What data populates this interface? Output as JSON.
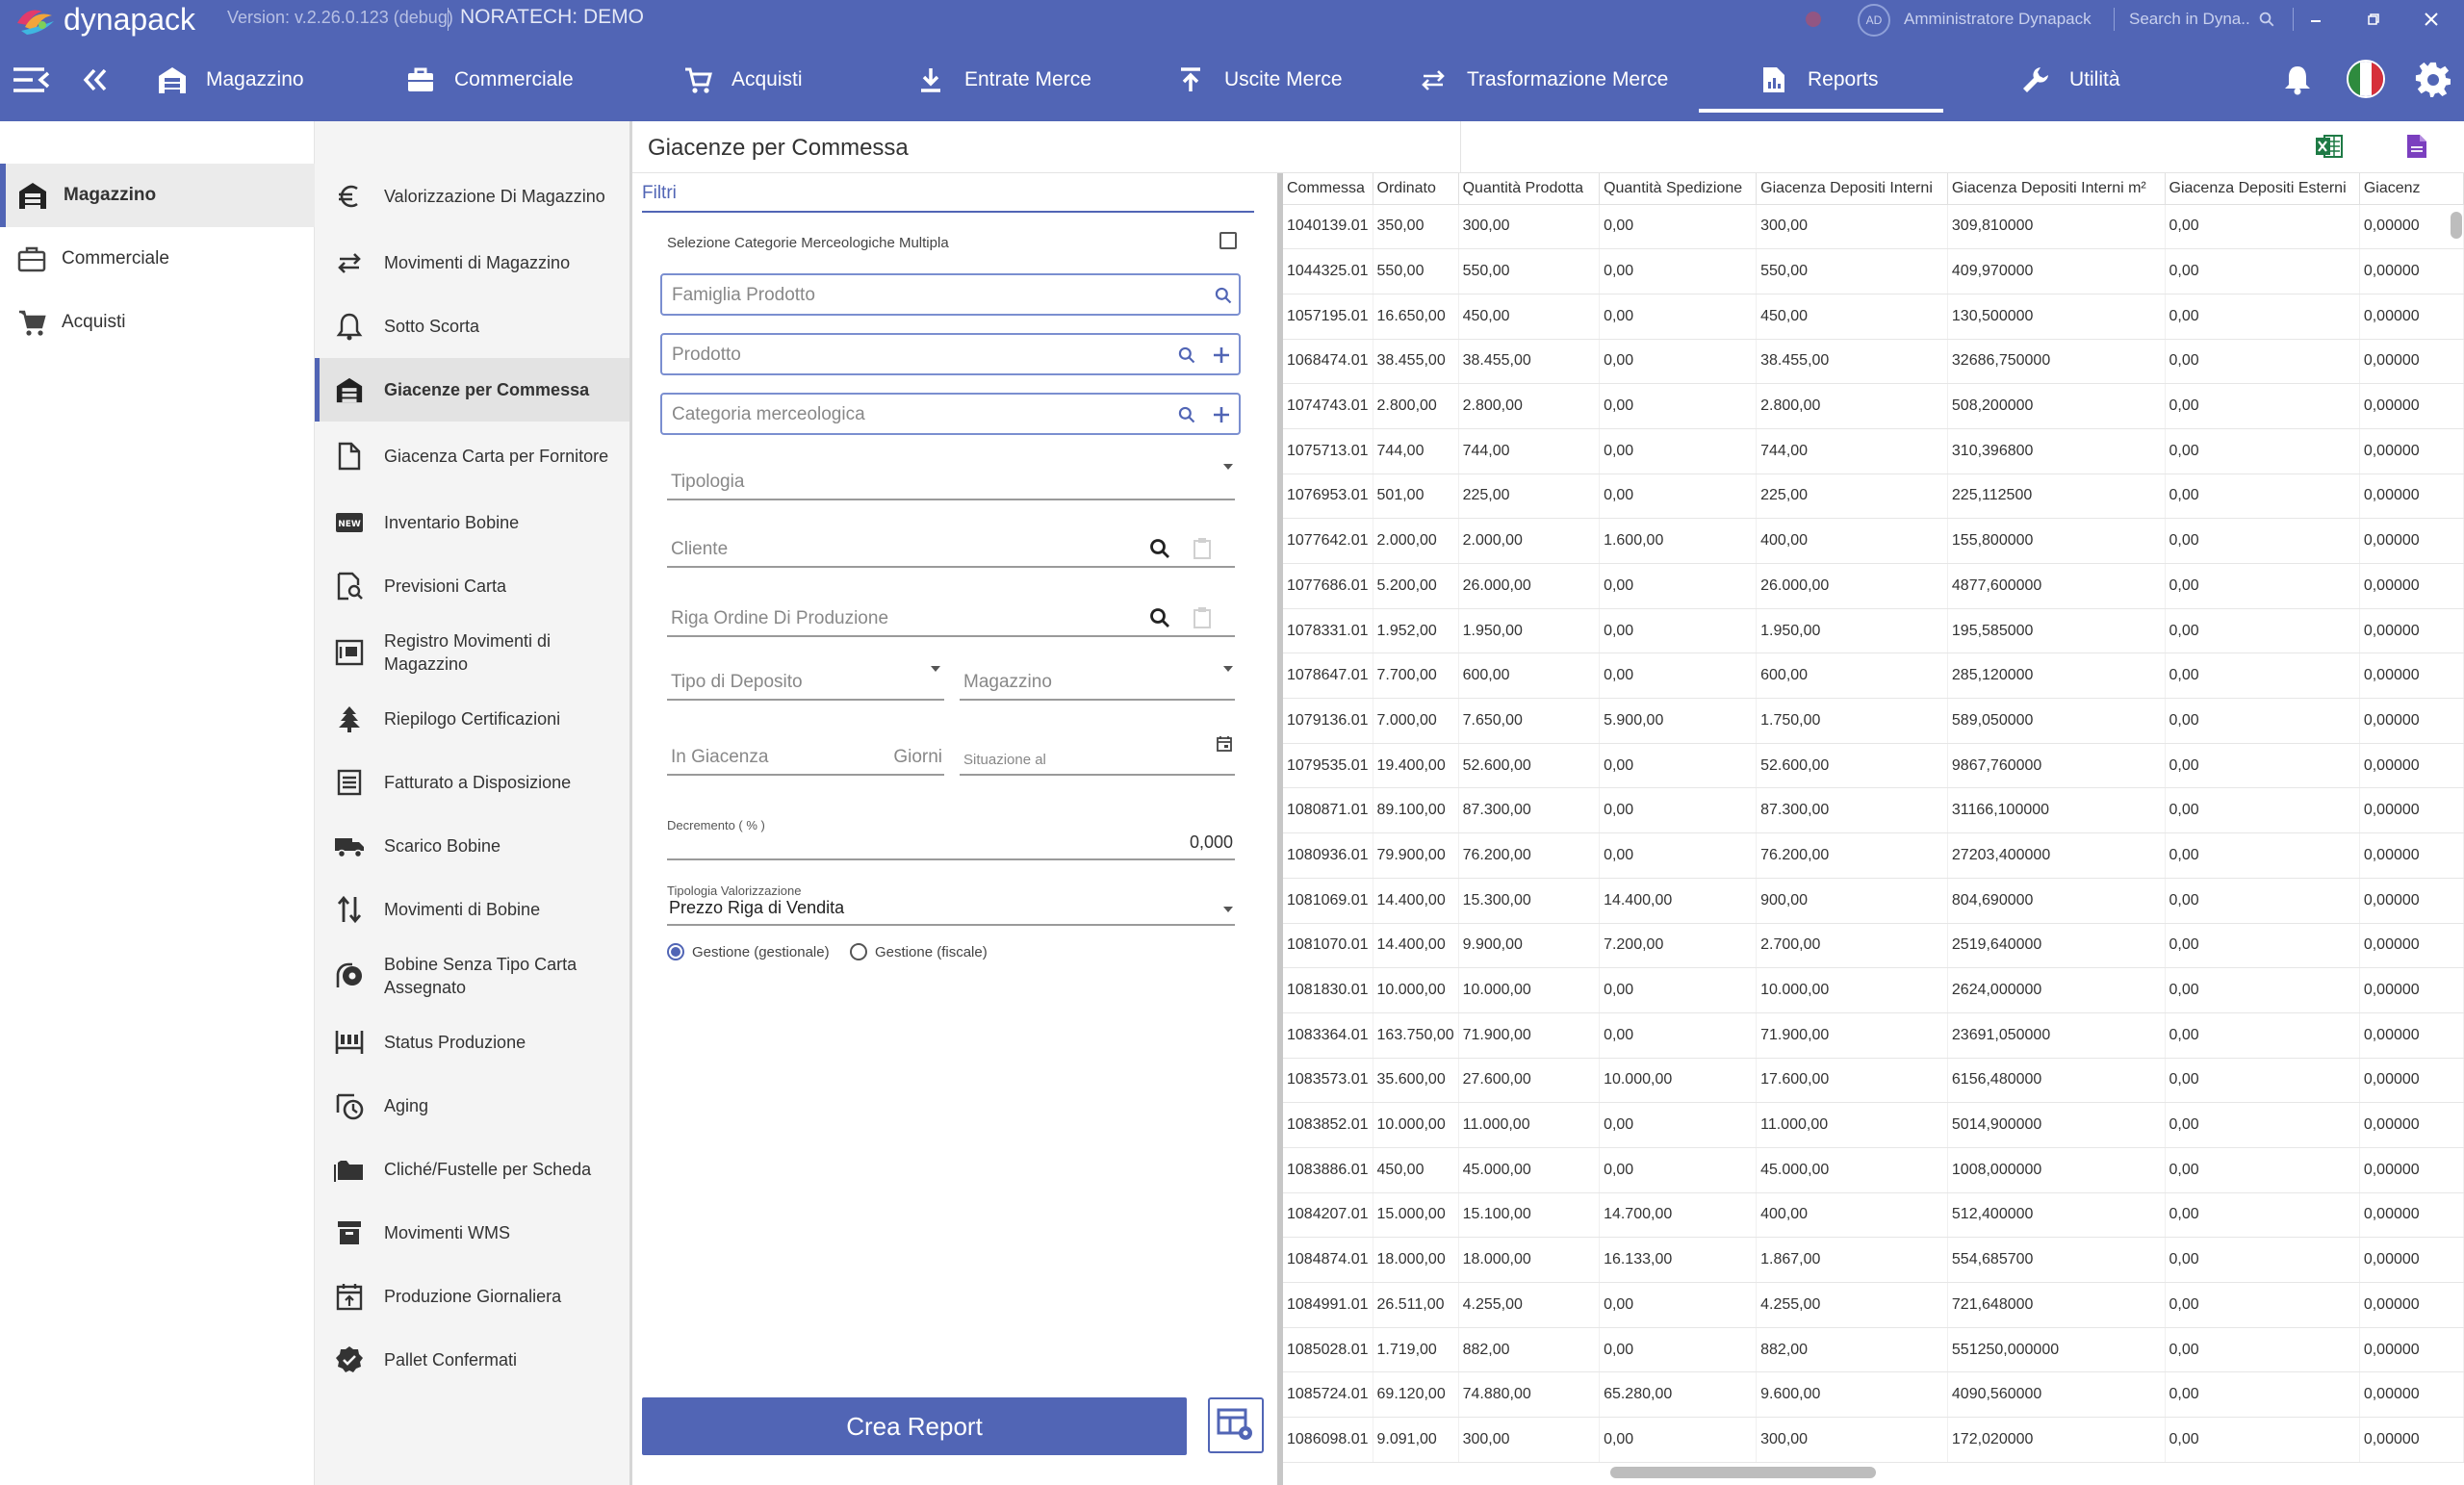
{
  "titlebar": {
    "app_name": "dynapack",
    "version": "Version: v.2.26.0.123 (debug)",
    "company": "NORATECH: DEMO",
    "avatar_initials": "AD",
    "user_name": "Amministratore Dynapack",
    "search_placeholder": "Search in Dyna.."
  },
  "navbar": {
    "items": [
      {
        "label": "Magazzino",
        "icon": "warehouse-icon"
      },
      {
        "label": "Commerciale",
        "icon": "briefcase-icon"
      },
      {
        "label": "Acquisti",
        "icon": "cart-icon"
      },
      {
        "label": "Entrate Merce",
        "icon": "download-icon"
      },
      {
        "label": "Uscite Merce",
        "icon": "upload-icon"
      },
      {
        "label": "Trasformazione Merce",
        "icon": "swap-icon"
      },
      {
        "label": "Reports",
        "icon": "report-icon"
      },
      {
        "label": "Utilità",
        "icon": "wrench-icon"
      }
    ],
    "active": "Reports",
    "accent": "#5165b5"
  },
  "leftnav": {
    "items": [
      {
        "label": "Magazzino"
      },
      {
        "label": "Commerciale"
      },
      {
        "label": "Acquisti"
      }
    ]
  },
  "subnav": {
    "items": [
      {
        "label": "Valorizzazione Di Magazzino",
        "icon": "euro-icon"
      },
      {
        "label": "Movimenti di Magazzino",
        "icon": "swap-icon"
      },
      {
        "label": "Sotto Scorta",
        "icon": "bell-alert-icon"
      },
      {
        "label": "Giacenze per Commessa",
        "icon": "warehouse-icon"
      },
      {
        "label": "Giacenza Carta per Fornitore",
        "icon": "file-icon"
      },
      {
        "label": "Inventario Bobine",
        "icon": "new-badge-icon",
        "badge": "NEW"
      },
      {
        "label": "Previsioni Carta",
        "icon": "search-document-icon"
      },
      {
        "label": "Registro Movimenti di Magazzino",
        "icon": "register-icon"
      },
      {
        "label": "Riepilogo Certificazioni",
        "icon": "tree-icon"
      },
      {
        "label": "Fatturato a Disposizione",
        "icon": "list-icon"
      },
      {
        "label": "Scarico Bobine",
        "icon": "truck-icon"
      },
      {
        "label": "Movimenti di Bobine",
        "icon": "sort-arrows-icon"
      },
      {
        "label": "Bobine Senza Tipo Carta Assegnato",
        "icon": "roll-icon"
      },
      {
        "label": "Status Produzione",
        "icon": "production-icon"
      },
      {
        "label": "Aging",
        "icon": "history-icon"
      },
      {
        "label": "Cliché/Fustelle per Scheda",
        "icon": "folder-icon"
      },
      {
        "label": "Movimenti WMS",
        "icon": "archive-icon"
      },
      {
        "label": "Produzione Giornaliera",
        "icon": "calendar-icon"
      },
      {
        "label": "Pallet Confermati",
        "icon": "verified-icon"
      }
    ],
    "active": "Giacenze per Commessa"
  },
  "page": {
    "title": "Giacenze per Commessa",
    "export_icons": [
      "excel-icon",
      "pdf-icon"
    ]
  },
  "filters": {
    "section_label": "Filtri",
    "multi_category_label": "Selezione Categorie Merceologiche Multipla",
    "famiglia_placeholder": "Famiglia Prodotto",
    "prodotto_placeholder": "Prodotto",
    "categoria_placeholder": "Categoria merceologica",
    "tipologia_placeholder": "Tipologia",
    "cliente_placeholder": "Cliente",
    "riga_ordine_placeholder": "Riga Ordine Di Produzione",
    "tipo_deposito_placeholder": "Tipo di Deposito",
    "magazzino_placeholder": "Magazzino",
    "in_giacenza_placeholder": "In Giacenza",
    "giorni_suffix": "Giorni",
    "situazione_placeholder": "Situazione al",
    "decremento_label": "Decremento ( % )",
    "decremento_value": "0,000",
    "tipologia_valorizzazione_label": "Tipologia Valorizzazione",
    "tipologia_valorizzazione_value": "Prezzo Riga di Vendita",
    "radio_gestionale": "Gestione (gestionale)",
    "radio_fiscale": "Gestione (fiscale)",
    "crea_report": "Crea Report"
  },
  "table": {
    "columns": [
      "Commessa",
      "Ordinato",
      "Quantità Prodotta",
      "Quantità Spedizione",
      "Giacenza Depositi Interni",
      "Giacenza Depositi Interni m²",
      "Giacenza Depositi Esterni",
      "Giacenz"
    ],
    "rows": [
      [
        "1040139.01",
        "350,00",
        "300,00",
        "0,00",
        "300,00",
        "309,810000",
        "0,00",
        "0,00000"
      ],
      [
        "1044325.01",
        "550,00",
        "550,00",
        "0,00",
        "550,00",
        "409,970000",
        "0,00",
        "0,00000"
      ],
      [
        "1057195.01",
        "16.650,00",
        "450,00",
        "0,00",
        "450,00",
        "130,500000",
        "0,00",
        "0,00000"
      ],
      [
        "1068474.01",
        "38.455,00",
        "38.455,00",
        "0,00",
        "38.455,00",
        "32686,750000",
        "0,00",
        "0,00000"
      ],
      [
        "1074743.01",
        "2.800,00",
        "2.800,00",
        "0,00",
        "2.800,00",
        "508,200000",
        "0,00",
        "0,00000"
      ],
      [
        "1075713.01",
        "744,00",
        "744,00",
        "0,00",
        "744,00",
        "310,396800",
        "0,00",
        "0,00000"
      ],
      [
        "1076953.01",
        "501,00",
        "225,00",
        "0,00",
        "225,00",
        "225,112500",
        "0,00",
        "0,00000"
      ],
      [
        "1077642.01",
        "2.000,00",
        "2.000,00",
        "1.600,00",
        "400,00",
        "155,800000",
        "0,00",
        "0,00000"
      ],
      [
        "1077686.01",
        "5.200,00",
        "26.000,00",
        "0,00",
        "26.000,00",
        "4877,600000",
        "0,00",
        "0,00000"
      ],
      [
        "1078331.01",
        "1.952,00",
        "1.950,00",
        "0,00",
        "1.950,00",
        "195,585000",
        "0,00",
        "0,00000"
      ],
      [
        "1078647.01",
        "7.700,00",
        "600,00",
        "0,00",
        "600,00",
        "285,120000",
        "0,00",
        "0,00000"
      ],
      [
        "1079136.01",
        "7.000,00",
        "7.650,00",
        "5.900,00",
        "1.750,00",
        "589,050000",
        "0,00",
        "0,00000"
      ],
      [
        "1079535.01",
        "19.400,00",
        "52.600,00",
        "0,00",
        "52.600,00",
        "9867,760000",
        "0,00",
        "0,00000"
      ],
      [
        "1080871.01",
        "89.100,00",
        "87.300,00",
        "0,00",
        "87.300,00",
        "31166,100000",
        "0,00",
        "0,00000"
      ],
      [
        "1080936.01",
        "79.900,00",
        "76.200,00",
        "0,00",
        "76.200,00",
        "27203,400000",
        "0,00",
        "0,00000"
      ],
      [
        "1081069.01",
        "14.400,00",
        "15.300,00",
        "14.400,00",
        "900,00",
        "804,690000",
        "0,00",
        "0,00000"
      ],
      [
        "1081070.01",
        "14.400,00",
        "9.900,00",
        "7.200,00",
        "2.700,00",
        "2519,640000",
        "0,00",
        "0,00000"
      ],
      [
        "1081830.01",
        "10.000,00",
        "10.000,00",
        "0,00",
        "10.000,00",
        "2624,000000",
        "0,00",
        "0,00000"
      ],
      [
        "1083364.01",
        "163.750,00",
        "71.900,00",
        "0,00",
        "71.900,00",
        "23691,050000",
        "0,00",
        "0,00000"
      ],
      [
        "1083573.01",
        "35.600,00",
        "27.600,00",
        "10.000,00",
        "17.600,00",
        "6156,480000",
        "0,00",
        "0,00000"
      ],
      [
        "1083852.01",
        "10.000,00",
        "11.000,00",
        "0,00",
        "11.000,00",
        "5014,900000",
        "0,00",
        "0,00000"
      ],
      [
        "1083886.01",
        "450,00",
        "45.000,00",
        "0,00",
        "45.000,00",
        "1008,000000",
        "0,00",
        "0,00000"
      ],
      [
        "1084207.01",
        "15.000,00",
        "15.100,00",
        "14.700,00",
        "400,00",
        "512,400000",
        "0,00",
        "0,00000"
      ],
      [
        "1084874.01",
        "18.000,00",
        "18.000,00",
        "16.133,00",
        "1.867,00",
        "554,685700",
        "0,00",
        "0,00000"
      ],
      [
        "1084991.01",
        "26.511,00",
        "4.255,00",
        "0,00",
        "4.255,00",
        "721,648000",
        "0,00",
        "0,00000"
      ],
      [
        "1085028.01",
        "1.719,00",
        "882,00",
        "0,00",
        "882,00",
        "551250,000000",
        "0,00",
        "0,00000"
      ],
      [
        "1085724.01",
        "69.120,00",
        "74.880,00",
        "65.280,00",
        "9.600,00",
        "4090,560000",
        "0,00",
        "0,00000"
      ],
      [
        "1086098.01",
        "9.091,00",
        "300,00",
        "0,00",
        "300,00",
        "172,020000",
        "0,00",
        "0,00000"
      ]
    ]
  }
}
